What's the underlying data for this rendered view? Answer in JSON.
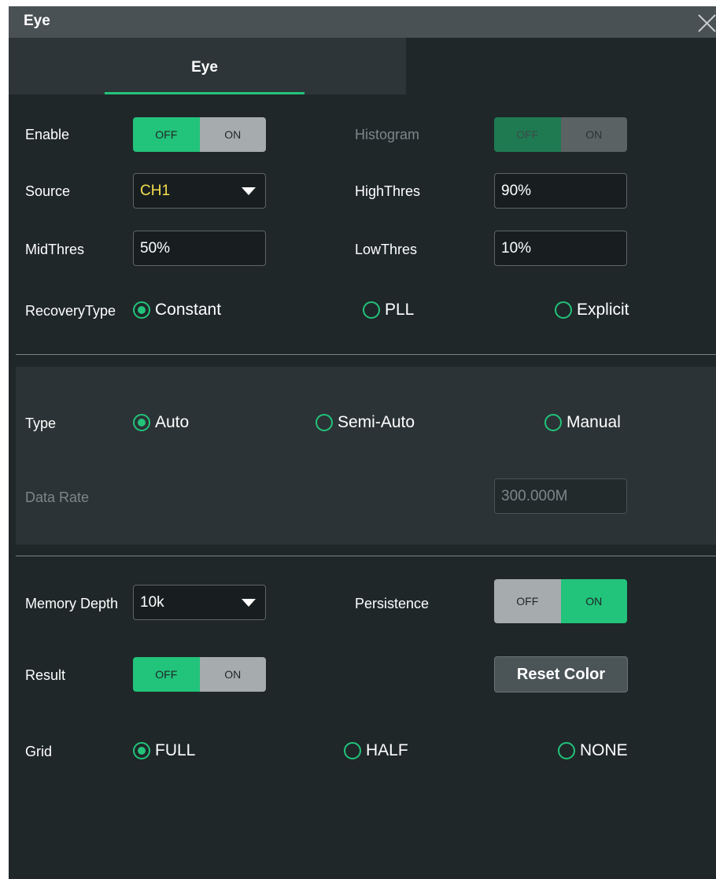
{
  "window": {
    "title": "Eye"
  },
  "tabs": [
    {
      "label": "Eye",
      "active": true
    }
  ],
  "enable": {
    "label": "Enable",
    "off": "OFF",
    "on": "ON",
    "state": "OFF"
  },
  "histogram": {
    "label": "Histogram",
    "off": "OFF",
    "on": "ON",
    "state": "OFF",
    "disabled": true
  },
  "source": {
    "label": "Source",
    "value": "CH1"
  },
  "high_thres": {
    "label": "HighThres",
    "value": "90%"
  },
  "mid_thres": {
    "label": "MidThres",
    "value": "50%"
  },
  "low_thres": {
    "label": "LowThres",
    "value": "10%"
  },
  "recovery_type": {
    "label": "RecoveryType",
    "options": [
      "Constant",
      "PLL",
      "Explicit"
    ],
    "selected": "Constant"
  },
  "type": {
    "label": "Type",
    "options": [
      "Auto",
      "Semi-Auto",
      "Manual"
    ],
    "selected": "Auto"
  },
  "data_rate": {
    "label": "Data Rate",
    "value": "300.000M",
    "disabled": true
  },
  "memory_depth": {
    "label": "Memory Depth",
    "value": "10k"
  },
  "persistence": {
    "label": "Persistence",
    "off": "OFF",
    "on": "ON",
    "state": "ON"
  },
  "result": {
    "label": "Result",
    "off": "OFF",
    "on": "ON",
    "state": "OFF"
  },
  "reset_color": {
    "label": "Reset Color"
  },
  "grid": {
    "label": "Grid",
    "options": [
      "FULL",
      "HALF",
      "NONE"
    ],
    "selected": "FULL"
  },
  "colors": {
    "accent": "#22c37a",
    "background": "#1f2729",
    "titlebar": "#4a5154",
    "source_text": "#f5df4d"
  },
  "icons": {
    "close": "close-icon",
    "dropdown": "caret-down-icon",
    "radio": "radio-icon"
  }
}
